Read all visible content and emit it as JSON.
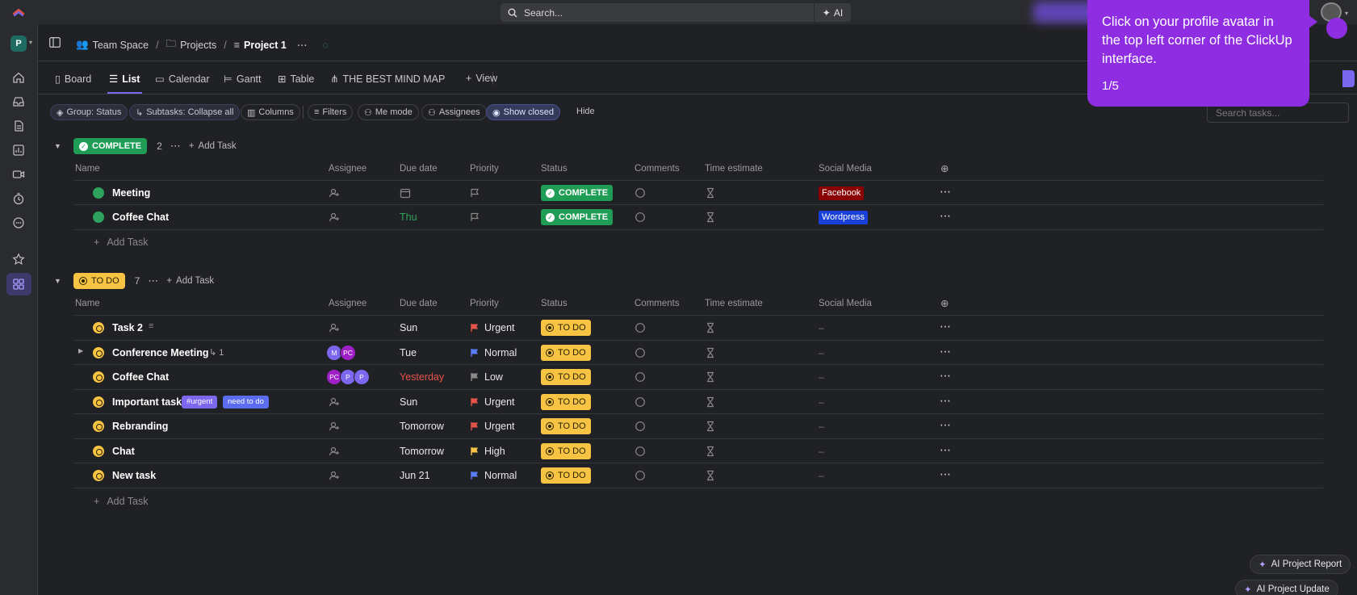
{
  "topbar": {
    "search_placeholder": "Search...",
    "ai_label": "AI"
  },
  "sidebar": {
    "workspace_initial": "P",
    "items": [
      "home",
      "inbox",
      "docs",
      "dashboards",
      "clips",
      "timesheets",
      "more",
      "favorites",
      "spaces"
    ]
  },
  "breadcrumb": {
    "space": "Team Space",
    "folder": "Projects",
    "list": "Project 1",
    "sep": "/"
  },
  "views": {
    "tabs": [
      "Board",
      "List",
      "Calendar",
      "Gantt",
      "Table",
      "THE BEST MIND MAP"
    ],
    "active": "List",
    "add_view": "View"
  },
  "filters": {
    "group": "Group: Status",
    "subtasks": "Subtasks: Collapse all",
    "columns": "Columns",
    "filters": "Filters",
    "me_mode": "Me mode",
    "assignees": "Assignees",
    "show_closed": "Show closed",
    "hide": "Hide",
    "search_placeholder": "Search tasks..."
  },
  "columns": [
    "Name",
    "Assignee",
    "Due date",
    "Priority",
    "Status",
    "Comments",
    "Time estimate",
    "Social Media"
  ],
  "groups": [
    {
      "status": "COMPLETE",
      "count": "2",
      "add_label": "Add Task",
      "tasks": [
        {
          "name": "Meeting",
          "due": "",
          "priority": "",
          "status": "COMPLETE",
          "social": "Facebook"
        },
        {
          "name": "Coffee Chat",
          "due": "Thu",
          "priority": "",
          "status": "COMPLETE",
          "social": "Wordpress"
        }
      ]
    },
    {
      "status": "TO DO",
      "count": "7",
      "add_label": "Add Task",
      "tasks": [
        {
          "name": "Task 2",
          "due": "Sun",
          "priority": "Urgent",
          "status": "TO DO",
          "social": "–"
        },
        {
          "name": "Conference Meeting",
          "subtask_count": "1",
          "assignees": [
            "M",
            "PC"
          ],
          "due": "Tue",
          "priority": "Normal",
          "status": "TO DO",
          "social": "–"
        },
        {
          "name": "Coffee Chat",
          "assignees": [
            "PC",
            "P",
            "P"
          ],
          "due": "Yesterday",
          "priority": "Low",
          "status": "TO DO",
          "social": "–"
        },
        {
          "name": "Important task",
          "tags": [
            "#urgent",
            "need to do"
          ],
          "due": "Sun",
          "priority": "Urgent",
          "status": "TO DO",
          "social": "–"
        },
        {
          "name": "Rebranding",
          "due": "Tomorrow",
          "priority": "Urgent",
          "status": "TO DO",
          "social": "–"
        },
        {
          "name": "Chat",
          "due": "Tomorrow",
          "priority": "High",
          "status": "TO DO",
          "social": "–"
        },
        {
          "name": "New task",
          "due": "Jun 21",
          "priority": "Normal",
          "status": "TO DO",
          "social": "–"
        }
      ]
    }
  ],
  "add_task_row": "Add Task",
  "tooltip": {
    "message": "Click on your profile avatar in the top left corner of the ClickUp interface.",
    "step": "1/5"
  },
  "bottom_buttons": {
    "report": "AI Project Report",
    "update": "AI Project Update"
  },
  "colors": {
    "accent": "#7b68ee",
    "complete": "#1f9d55",
    "todo": "#f6c343",
    "tooltip": "#8e2de2",
    "urgent": "#e5534b",
    "normal": "#5b7cfa",
    "high": "#f6c343",
    "low": "#8a8a8a",
    "facebook": "#8b0000",
    "wordpress": "#1a3fd8",
    "overdue": "#e5534b",
    "due_complete": "#2ea35d"
  }
}
